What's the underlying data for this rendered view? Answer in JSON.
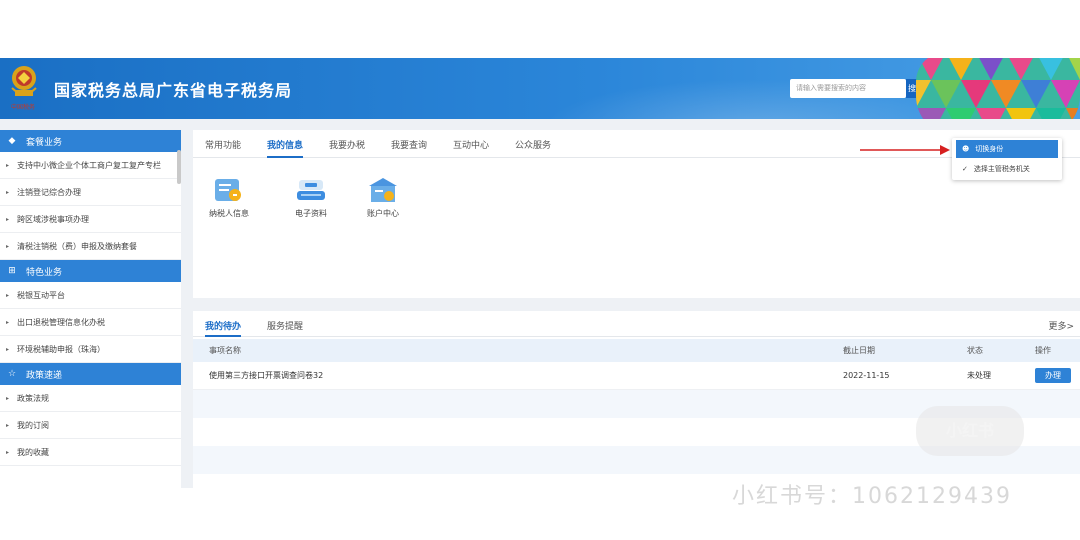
{
  "header": {
    "site_title": "国家税务总局广东省电子税务局",
    "emblem_text": "中国税务",
    "search_placeholder": "请输入需要搜索的内容",
    "search_btn": "搜"
  },
  "sidebar": {
    "sections": [
      {
        "title": "套餐业务",
        "icon": "cube-icon",
        "items": [
          "支持中小微企业个体工商户复工复产专栏",
          "注销登记综合办理",
          "跨区域涉税事项办理",
          "清税注销税（费）申报及缴纳套餐"
        ]
      },
      {
        "title": "特色业务",
        "icon": "grid-icon",
        "items": [
          "税银互动平台",
          "出口退税管理信息化办税",
          "环境税辅助申报（珠海）"
        ]
      },
      {
        "title": "政策速递",
        "icon": "star-icon",
        "items": [
          "政策法规",
          "我的订阅",
          "我的收藏"
        ]
      }
    ]
  },
  "main": {
    "tabs": [
      "常用功能",
      "我的信息",
      "我要办税",
      "我要查询",
      "互动中心",
      "公众服务"
    ],
    "active_tab": 1,
    "apps": [
      {
        "label": "纳税人信息",
        "icon": "taxpayer-info-icon"
      },
      {
        "label": "电子资料",
        "icon": "electronic-data-icon"
      },
      {
        "label": "账户中心",
        "icon": "account-center-icon"
      }
    ]
  },
  "dropdown": {
    "items": [
      "切换身份",
      "选择主管税务机关"
    ]
  },
  "todo": {
    "tabs": [
      "我的待办",
      "服务提醒"
    ],
    "more": "更多>",
    "columns": [
      "事项名称",
      "截止日期",
      "状态",
      "操作"
    ],
    "rows": [
      {
        "name": "使用第三方接口开票调查问卷32",
        "deadline": "2022-11-15",
        "status": "未处理",
        "action": "办理"
      }
    ]
  },
  "watermark": {
    "text": "小红书号：1062129439",
    "logo": "小红书"
  },
  "colors": {
    "header_blue": "#2b86d9",
    "accent_blue": "#2e82d6",
    "active_tab": "#1c6dc7"
  }
}
